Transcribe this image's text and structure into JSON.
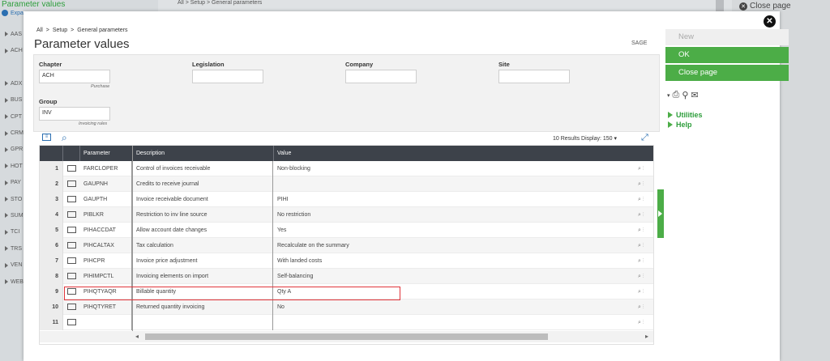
{
  "background": {
    "title": "Parameter values",
    "expand_label": "Expa",
    "nav_items": [
      "AAS",
      "ACH",
      "",
      "ADX",
      "BUS",
      "CPT",
      "CRM",
      "GPR",
      "HOT",
      "PAY",
      "STO",
      "SUM",
      "TCI",
      "TRS",
      "VEN",
      "WEB"
    ],
    "breadcrumb": "All  >  Setup  >  General parameters",
    "close_page": "Close page"
  },
  "modal": {
    "breadcrumb": {
      "all": "All",
      "setup": "Setup",
      "general": "General parameters",
      "sep": ">"
    },
    "title": "Parameter values",
    "badge": "SAGE",
    "form": {
      "chapter_label": "Chapter",
      "chapter_value": "ACH",
      "chapter_hint": "Purchase",
      "legislation_label": "Legislation",
      "legislation_value": "",
      "company_label": "Company",
      "company_value": "",
      "site_label": "Site",
      "site_value": "",
      "group_label": "Group",
      "group_value": "INV",
      "group_hint": "Invoicing rules"
    },
    "results_text": "10 Results  Display:",
    "display_value": "150",
    "grid": {
      "headers": {
        "parameter": "Parameter",
        "description": "Description",
        "value": "Value"
      },
      "rows": [
        {
          "num": "1",
          "param": "FARCLOPER",
          "desc": "Control of invoices receivable",
          "value": "Non-blocking"
        },
        {
          "num": "2",
          "param": "GAUPNH",
          "desc": "Credits to receive journal",
          "value": ""
        },
        {
          "num": "3",
          "param": "GAUPTH",
          "desc": "Invoice receivable document",
          "value": "PIHI"
        },
        {
          "num": "4",
          "param": "PIBLKR",
          "desc": "Restriction to inv line source",
          "value": "No restriction"
        },
        {
          "num": "5",
          "param": "PIHACCDAT",
          "desc": "Allow account date changes",
          "value": "Yes"
        },
        {
          "num": "6",
          "param": "PIHCALTAX",
          "desc": "Tax calculation",
          "value": "Recalculate on the summary"
        },
        {
          "num": "7",
          "param": "PIHCPR",
          "desc": "Invoice price adjustment",
          "value": "With landed costs"
        },
        {
          "num": "8",
          "param": "PIHIMPCTL",
          "desc": "Invoicing elements on import",
          "value": "Self-balancing"
        },
        {
          "num": "9",
          "param": "PIHQTYAQR",
          "desc": "Billable quantity",
          "value": "Qty A"
        },
        {
          "num": "10",
          "param": "PIHQTYRET",
          "desc": "Returned quantity invoicing",
          "value": "No"
        },
        {
          "num": "11",
          "param": "",
          "desc": "",
          "value": ""
        }
      ],
      "scroll_left": "◂",
      "scroll_right": "▸"
    }
  },
  "right_panel": {
    "new": "New",
    "ok": "OK",
    "close_page": "Close page",
    "utilities": "Utilities",
    "help": "Help"
  }
}
